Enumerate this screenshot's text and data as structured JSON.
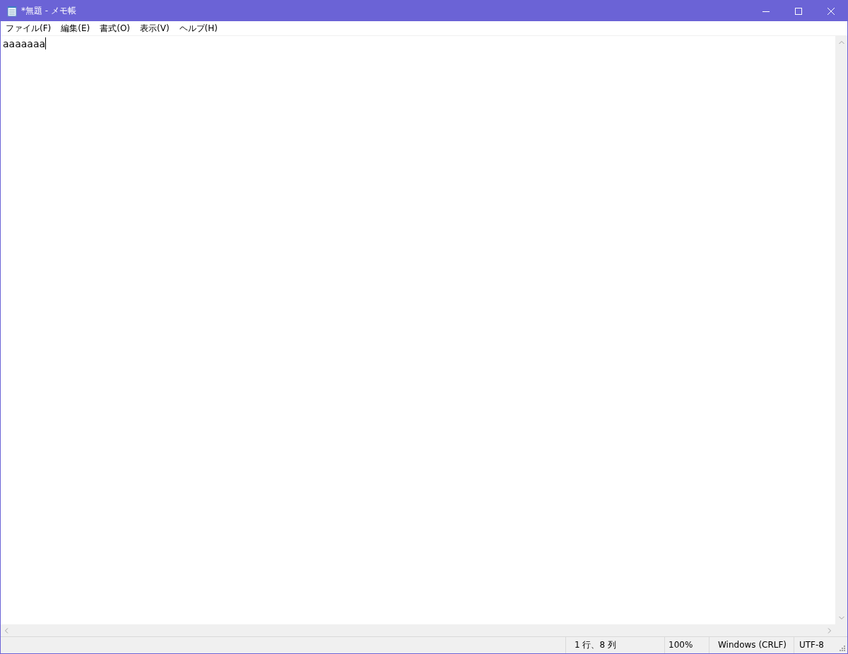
{
  "window": {
    "title": "*無題 - メモ帳"
  },
  "menu": [
    "ファイル(F)",
    "編集(E)",
    "書式(O)",
    "表示(V)",
    "ヘルプ(H)"
  ],
  "editor": {
    "text": "aaaaaaa"
  },
  "status_bar": [
    "1 行、8 列",
    "100%",
    "Windows (CRLF)",
    "UTF-8"
  ]
}
